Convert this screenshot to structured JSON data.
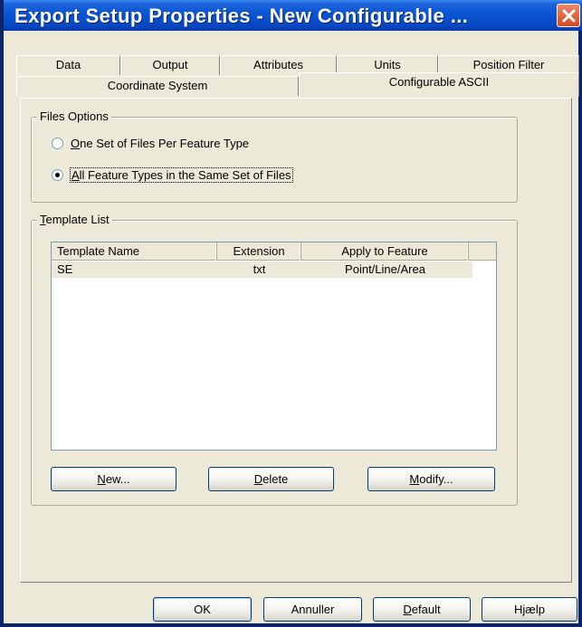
{
  "window": {
    "title": "Export Setup Properties - New Configurable ..."
  },
  "tabs": {
    "row1": [
      "Data",
      "Output",
      "Attributes",
      "Units",
      "Position Filter"
    ],
    "row2": [
      "Coordinate System",
      "Configurable ASCII"
    ],
    "active": "Configurable ASCII"
  },
  "files_options": {
    "title": "Files Options",
    "option1": {
      "prefix": "O",
      "rest": "ne Set of Files Per Feature Type",
      "selected": false
    },
    "option2": {
      "prefix": "A",
      "rest": "ll Feature Types in the Same Set of Files",
      "selected": true
    }
  },
  "template_list": {
    "title_prefix": "T",
    "title_rest": "emplate List",
    "columns": [
      "Template Name",
      "Extension",
      "Apply to Feature"
    ],
    "rows": [
      {
        "name": "SE",
        "extension": "txt",
        "apply": "Point/Line/Area"
      }
    ],
    "buttons": {
      "new": {
        "prefix": "N",
        "rest": "ew..."
      },
      "delete": {
        "prefix": "D",
        "rest": "elete"
      },
      "modify": {
        "prefix": "M",
        "rest": "odify..."
      }
    }
  },
  "footer": {
    "ok": "OK",
    "cancel": "Annuller",
    "default": {
      "prefix": "D",
      "rest": "efault"
    },
    "help": "Hjælp"
  }
}
